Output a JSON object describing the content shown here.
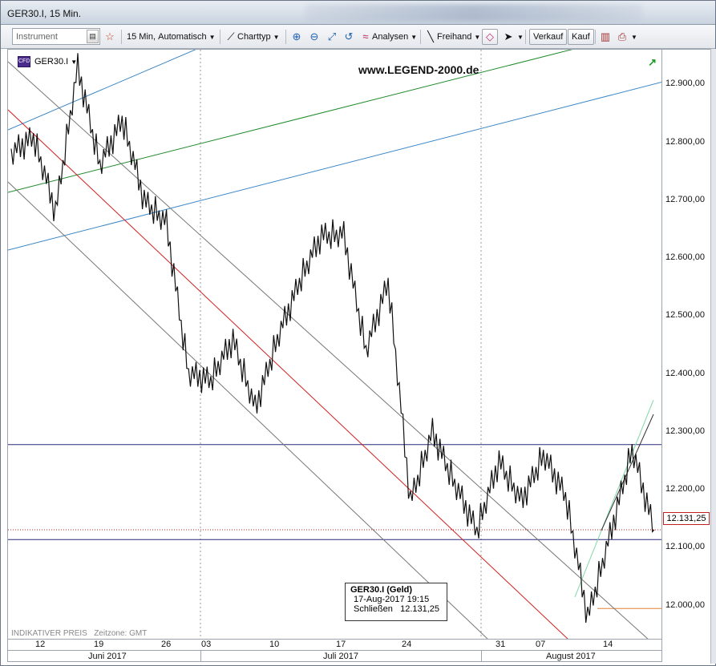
{
  "window": {
    "title": "GER30.I, 15 Min."
  },
  "toolbar": {
    "instrument_placeholder": "Instrument",
    "interval_label": "15 Min,",
    "scale_label": "Automatisch",
    "charttype_label": "Charttyp",
    "analysen_label": "Analysen",
    "freihand_label": "Freihand",
    "verkauf_label": "Verkauf",
    "kauf_label": "Kauf"
  },
  "chart": {
    "symbol": "GER30.I",
    "watermark": "www.LEGEND-2000.de",
    "indikativ": "INDIKATIVER PREIS",
    "zeitzone": "Zeitzone: GMT",
    "current_price": "12.131,25",
    "tooltip": {
      "title": "GER30.I (Geld)",
      "datetime": "17-Aug-2017 19:15",
      "close_label": "Schließen",
      "close_value": "12.131,25"
    },
    "colors": {
      "price_line": "#111111",
      "red_channel": "#d22020",
      "green_channel": "#1f8a2a",
      "blue_channel": "#3a87c8",
      "gray_channel": "#777777",
      "hline": "#2a2a7a",
      "orange_line": "#e08030"
    }
  },
  "chart_data": {
    "type": "line",
    "title": "GER30.I, 15 Min.",
    "ylim": [
      11940,
      12960
    ],
    "yticks": [
      "12.000,00",
      "12.100,00",
      "12.200,00",
      "12.300,00",
      "12.400,00",
      "12.500,00",
      "12.600,00",
      "12.700,00",
      "12.800,00",
      "12.900,00"
    ],
    "yticks_values": [
      12000,
      12100,
      12200,
      12300,
      12400,
      12500,
      12600,
      12700,
      12800,
      12900
    ],
    "xticks": [
      "12",
      "19",
      "26",
      "03",
      "10",
      "17",
      "24",
      "31",
      "07",
      "14"
    ],
    "months": [
      "Juni 2017",
      "Juli 2017",
      "August 2017"
    ],
    "x": [
      "2017-06-12",
      "2017-06-14",
      "2017-06-16",
      "2017-06-19",
      "2017-06-21",
      "2017-06-23",
      "2017-06-26",
      "2017-06-28",
      "2017-06-30",
      "2017-07-03",
      "2017-07-05",
      "2017-07-07",
      "2017-07-10",
      "2017-07-12",
      "2017-07-14",
      "2017-07-17",
      "2017-07-19",
      "2017-07-21",
      "2017-07-24",
      "2017-07-26",
      "2017-07-28",
      "2017-07-31",
      "2017-08-02",
      "2017-08-04",
      "2017-08-07",
      "2017-08-09",
      "2017-08-11",
      "2017-08-14",
      "2017-08-16",
      "2017-08-17"
    ],
    "series": [
      {
        "values": [
          12780,
          12810,
          12680,
          12930,
          12760,
          12840,
          12700,
          12660,
          12400,
          12390,
          12460,
          12340,
          12460,
          12560,
          12640,
          12640,
          12440,
          12560,
          12180,
          12300,
          12210,
          12130,
          12250,
          12180,
          12260,
          12190,
          11980,
          12120,
          12270,
          12131
        ]
      }
    ],
    "hlines": [
      12278,
      12131,
      12114,
      11995
    ]
  }
}
